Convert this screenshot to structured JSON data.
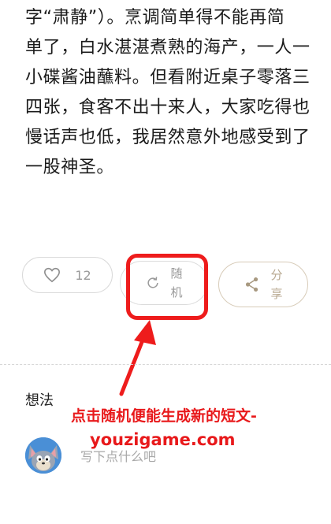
{
  "article": {
    "lines": [
      "字“肃静”）。烹调简单得不能再简",
      "单了，白水湛湛煮熟的海产，一人一",
      "小碟酱油蘸料。但看附近桌子零落三",
      "四张，食客不出十来人，大家吃得也",
      "慢话声也低，我居然意外地感受到了",
      "一股神圣。"
    ]
  },
  "actions": {
    "like": {
      "icon": "heart-icon",
      "count": "12"
    },
    "random": {
      "icon": "refresh-icon",
      "label_1": "随",
      "label_2": "机"
    },
    "share": {
      "icon": "share-icon",
      "label_1": "分",
      "label_2": "享"
    }
  },
  "comments": {
    "title": "想法",
    "placeholder": "写下点什么吧"
  },
  "annotation": {
    "line1": "点击随机便能生成新的短文-",
    "line2": "youzigame.com"
  },
  "colors": {
    "annotation": "#e8191b",
    "share_accent": "#b8a890",
    "border": "#d9d9d9"
  }
}
